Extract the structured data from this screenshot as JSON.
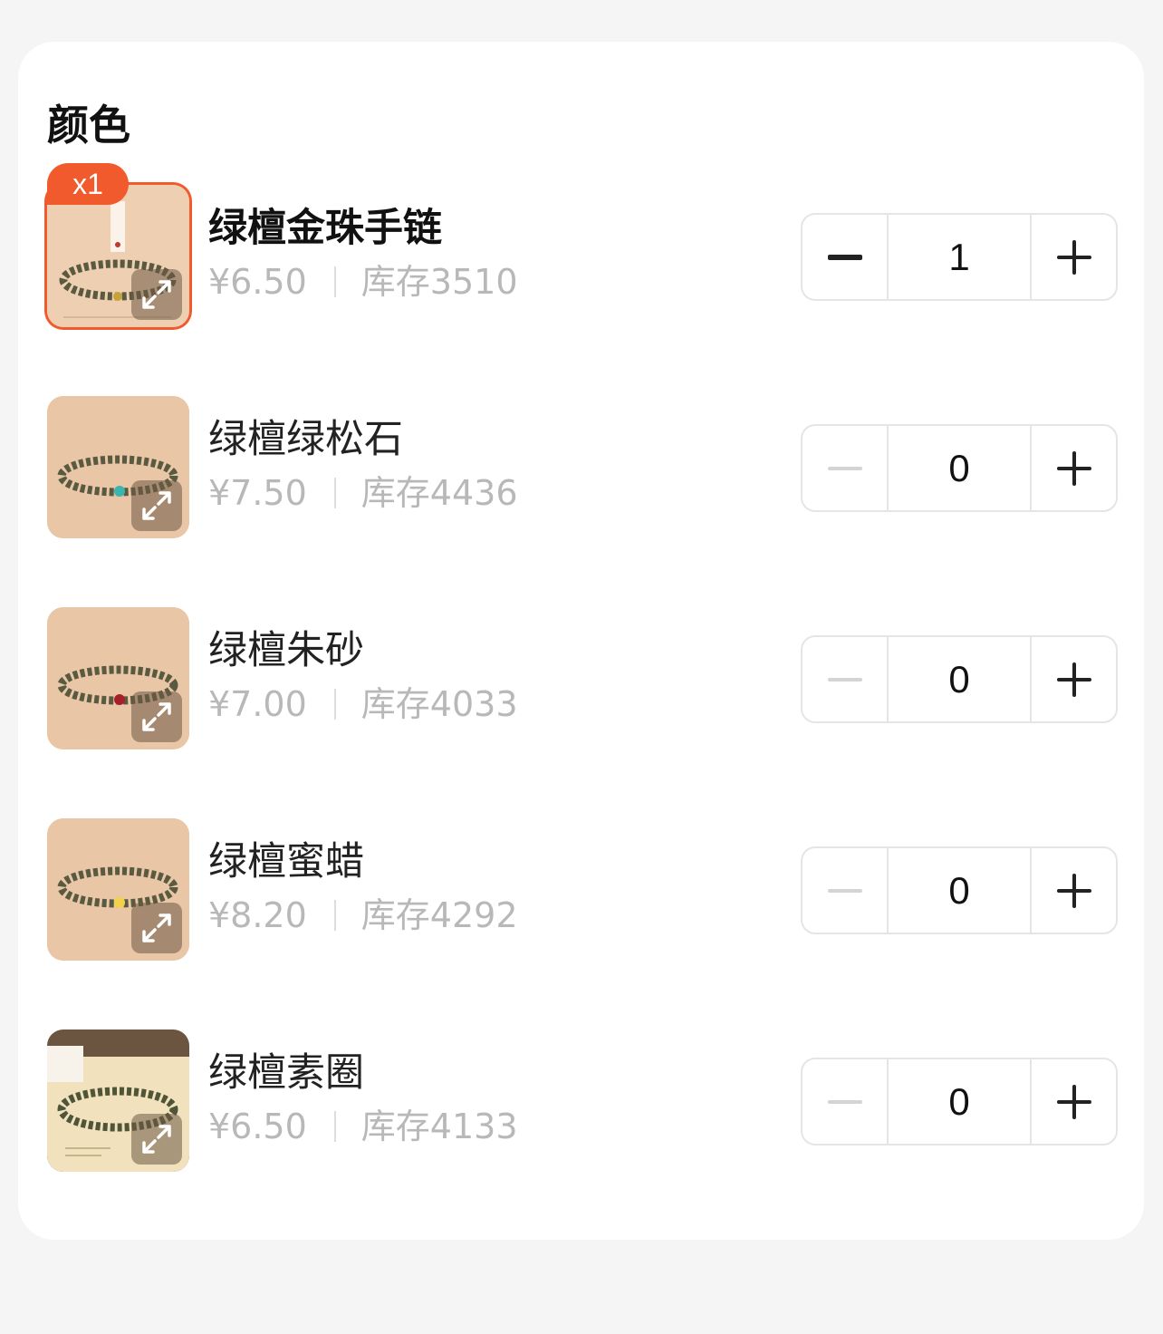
{
  "section": {
    "title": "颜色"
  },
  "items": [
    {
      "name": "绿檀金珠手链",
      "price": "¥6.50",
      "stock": "库存3510",
      "quantity": "1",
      "badge": "x1",
      "bead_color": "#c9a13a",
      "selected": true
    },
    {
      "name": "绿檀绿松石",
      "price": "¥7.50",
      "stock": "库存4436",
      "quantity": "0",
      "bead_color": "#3bb5b0",
      "selected": false
    },
    {
      "name": "绿檀朱砂",
      "price": "¥7.00",
      "stock": "库存4033",
      "quantity": "0",
      "bead_color": "#a81f2a",
      "selected": false
    },
    {
      "name": "绿檀蜜蜡",
      "price": "¥8.20",
      "stock": "库存4292",
      "quantity": "0",
      "bead_color": "#f2d24a",
      "selected": false
    },
    {
      "name": "绿檀素圈",
      "price": "¥6.50",
      "stock": "库存4133",
      "quantity": "0",
      "bead_color": "",
      "selected": false
    }
  ],
  "colors": {
    "accent": "#f05a2c",
    "price_gray": "#b8b8b8",
    "thumb_bg": "#e6c6a8"
  },
  "icons": {
    "zoom": "expand-icon",
    "decrement": "minus-icon",
    "increment": "plus-icon"
  }
}
